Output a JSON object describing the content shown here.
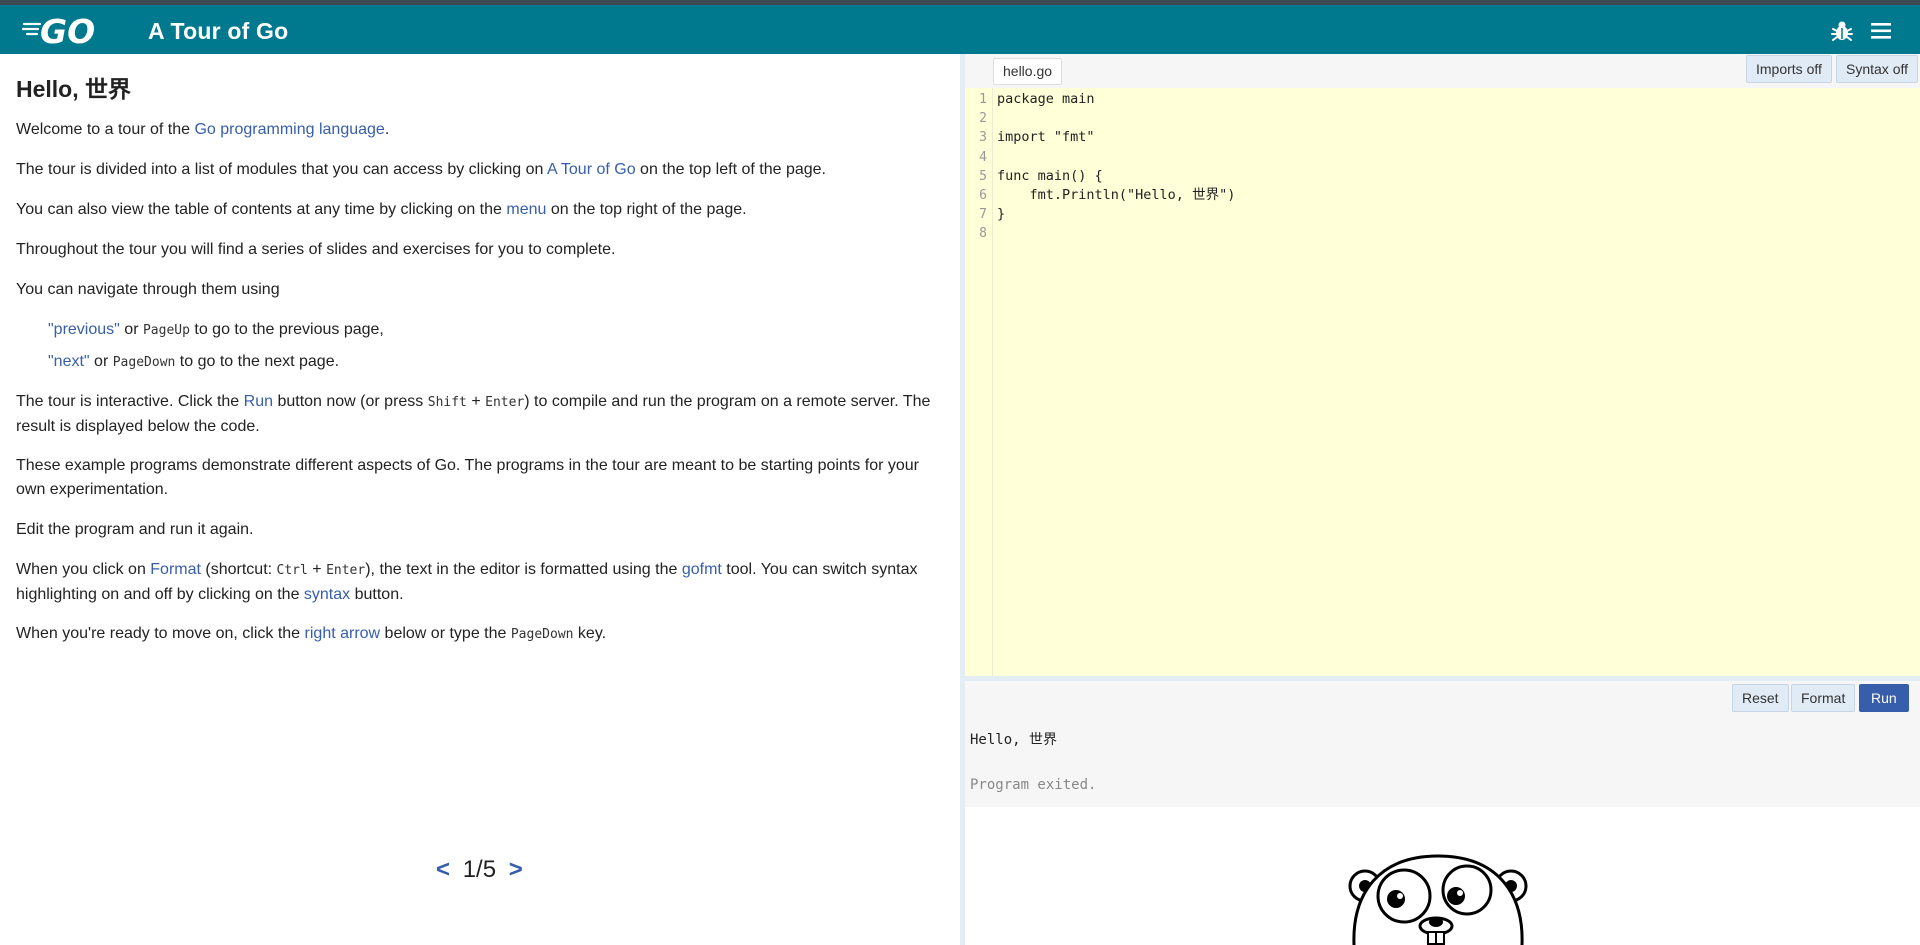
{
  "header": {
    "logo_text": "GO",
    "title": "A Tour of Go",
    "bug_icon": "bug-icon",
    "menu_icon": "hamburger-menu-icon"
  },
  "lesson": {
    "heading": "Hello, 世界",
    "p1": {
      "t1": "Welcome to a tour of the ",
      "link": "Go programming language",
      "t2": "."
    },
    "p2": {
      "t1": "The tour is divided into a list of modules that you can access by clicking on ",
      "link": "A Tour of Go",
      "t2": " on the top left of the page."
    },
    "p3": {
      "t1": "You can also view the table of contents at any time by clicking on the ",
      "link": "menu",
      "t2": " on the top right of the page."
    },
    "p4": "Throughout the tour you will find a series of slides and exercises for you to complete.",
    "p5": "You can navigate through them using",
    "nav1": {
      "link": "\"previous\"",
      "t1": " or ",
      "key": "PageUp",
      "t2": " to go to the previous page,"
    },
    "nav2": {
      "link": "\"next\"",
      "t1": " or ",
      "key": "PageDown",
      "t2": " to go to the next page."
    },
    "p6": {
      "t1": "The tour is interactive. Click the ",
      "link": "Run",
      "t2": " button now (or press ",
      "key1": "Shift",
      "plus": " + ",
      "key2": "Enter",
      "t3": ") to compile and run the program on a remote server. The result is displayed below the code."
    },
    "p7": "These example programs demonstrate different aspects of Go. The programs in the tour are meant to be starting points for your own experimentation.",
    "p8": "Edit the program and run it again.",
    "p9": {
      "t1": "When you click on ",
      "link1": "Format",
      "t2": " (shortcut: ",
      "key1": "Ctrl",
      "plus": " + ",
      "key2": "Enter",
      "t3": "), the text in the editor is formatted using the ",
      "link2": "gofmt",
      "t4": " tool. You can switch syntax highlighting on and off by clicking on the ",
      "link3": "syntax",
      "t5": " button."
    },
    "p10": {
      "t1": "When you're ready to move on, click the ",
      "link": "right arrow",
      "t2": " below or type the ",
      "key": "PageDown",
      "t3": " key."
    }
  },
  "pager": {
    "prev": "<",
    "page": "1/5",
    "next": ">"
  },
  "editor": {
    "filename": "hello.go",
    "imports_label": "Imports off",
    "syntax_label": "Syntax off",
    "line_numbers": [
      "1",
      "2",
      "3",
      "4",
      "5",
      "6",
      "7",
      "8"
    ],
    "lines": [
      "package main",
      "",
      "import \"fmt\"",
      "",
      "func main() {",
      "    fmt.Println(\"Hello, 世界\")",
      "}",
      ""
    ]
  },
  "output": {
    "reset_label": "Reset",
    "format_label": "Format",
    "run_label": "Run",
    "stdout": "Hello, 世界",
    "status": "Program exited."
  },
  "colors": {
    "header_bg": "#00798f",
    "link": "#375eab",
    "editor_bg": "#ffffd8",
    "run_button": "#375eab"
  }
}
